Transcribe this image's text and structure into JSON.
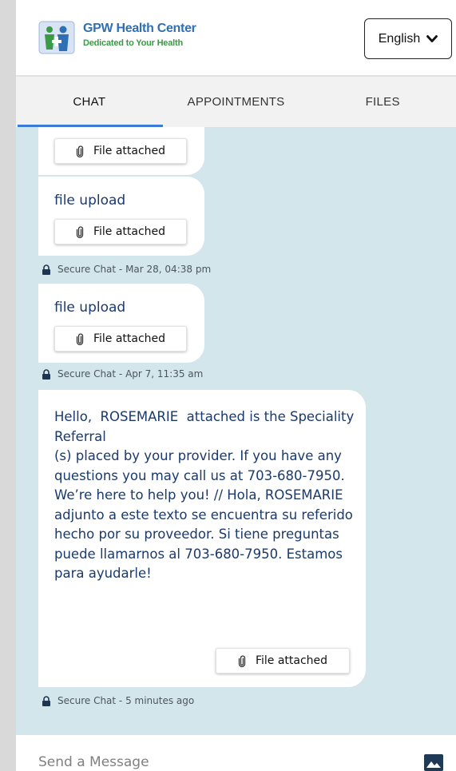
{
  "header": {
    "brand_name": "GPW Health Center",
    "brand_tagline": "Dedicated to Your Health",
    "language": "English"
  },
  "tabs": [
    {
      "label": "CHAT",
      "active": true
    },
    {
      "label": "APPOINTMENTS",
      "active": false
    },
    {
      "label": "FILES",
      "active": false
    }
  ],
  "messages": [
    {
      "text": "",
      "attachment": "File attached"
    },
    {
      "text": "file upload",
      "attachment": "File attached",
      "meta": "Secure Chat - Mar 28, 04:38 pm"
    },
    {
      "text": "file upload",
      "attachment": "File attached",
      "meta": "Secure Chat - Apr 7, 11:35 am"
    },
    {
      "text": "Hello,  ROSEMARIE  attached is the Speciality Referral\n(s) placed by your provider. If you have any questions you may call us at 703-680-7950. We’re here to help you! // Hola, ROSEMARIE adjunto a este texto se encuentra su referido hecho por su proveedor. Si tiene preguntas puede llamarnos al 703-680-7950. Estamos para ayudarle!",
      "attachment": "File attached",
      "meta": "Secure Chat - 5 minutes ago"
    }
  ],
  "composer": {
    "placeholder": "Send a Message"
  },
  "colors": {
    "chat_background": "#d3e6ec",
    "message_text": "#1a3a6e",
    "active_tab_underline": "#3a7bd5",
    "brand_blue": "#2f6fb4",
    "brand_green": "#3a9a45"
  },
  "icons": [
    "gpw-logo-icon",
    "chevron-down-icon",
    "paperclip-icon",
    "lock-icon",
    "image-icon"
  ]
}
